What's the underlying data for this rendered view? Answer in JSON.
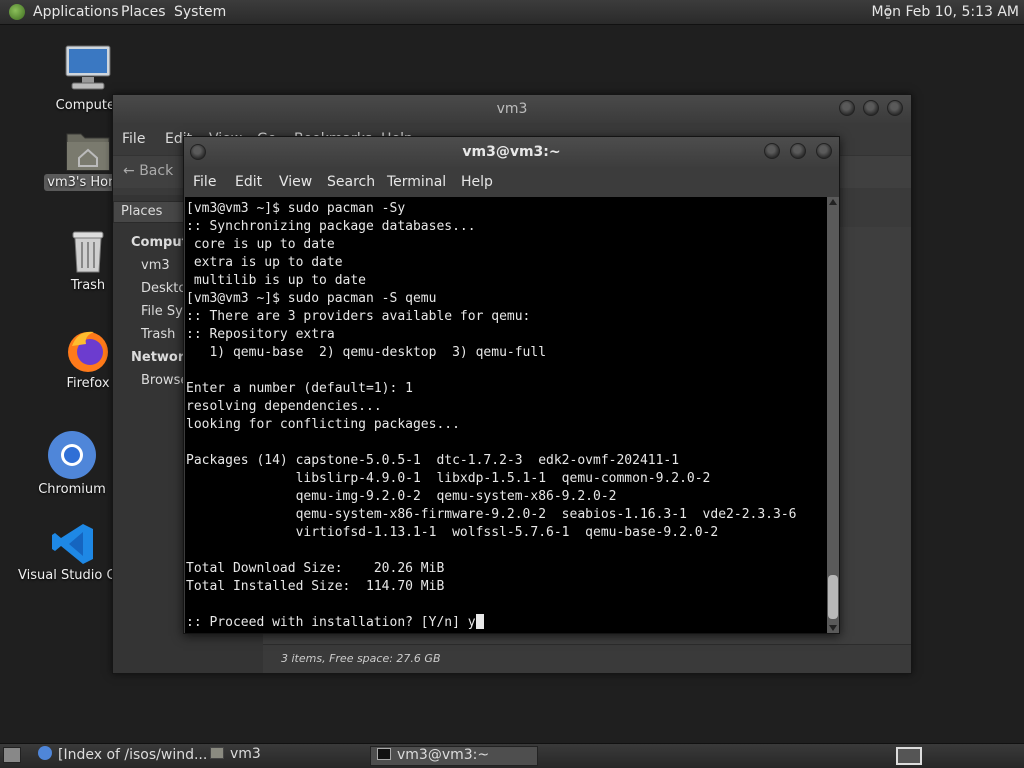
{
  "top_panel": {
    "menus": [
      "Applications",
      "Places",
      "System"
    ],
    "clock": "Mon Feb 10,  5:13 AM"
  },
  "desktop": {
    "icons": [
      {
        "label": "Computer",
        "icon": "computer-icon"
      },
      {
        "label": "vm3's Home",
        "icon": "home-folder-icon"
      },
      {
        "label": "Trash",
        "icon": "trash-icon"
      },
      {
        "label": "Firefox",
        "icon": "firefox-icon"
      },
      {
        "label": "Chromium",
        "icon": "chromium-icon"
      },
      {
        "label": "Visual Studio Code",
        "icon": "vscode-icon"
      }
    ]
  },
  "file_manager": {
    "title": "vm3",
    "menus": [
      "File",
      "Edit",
      "View",
      "Go",
      "Bookmarks",
      "Help"
    ],
    "back_label": "Back",
    "places_header": "Places",
    "sidebar": {
      "computer_header": "Computer",
      "computer_items": [
        "vm3",
        "Desktop",
        "File System",
        "Trash"
      ],
      "network_header": "Network",
      "network_items": [
        "Browse Network"
      ]
    },
    "status": "3 items, Free space: 27.6 GB"
  },
  "terminal": {
    "title": "vm3@vm3:~",
    "menus": [
      "File",
      "Edit",
      "View",
      "Search",
      "Terminal",
      "Help"
    ],
    "lines": [
      "[vm3@vm3 ~]$ sudo pacman -Sy",
      ":: Synchronizing package databases...",
      " core is up to date",
      " extra is up to date",
      " multilib is up to date",
      "[vm3@vm3 ~]$ sudo pacman -S qemu",
      ":: There are 3 providers available for qemu:",
      ":: Repository extra",
      "   1) qemu-base  2) qemu-desktop  3) qemu-full",
      "",
      "Enter a number (default=1): 1",
      "resolving dependencies...",
      "looking for conflicting packages...",
      "",
      "Packages (14) capstone-5.0.5-1  dtc-1.7.2-3  edk2-ovmf-202411-1",
      "              libslirp-4.9.0-1  libxdp-1.5.1-1  qemu-common-9.2.0-2",
      "              qemu-img-9.2.0-2  qemu-system-x86-9.2.0-2",
      "              qemu-system-x86-firmware-9.2.0-2  seabios-1.16.3-1  vde2-2.3.3-6",
      "              virtiofsd-1.13.1-1  wolfssl-5.7.6-1  qemu-base-9.2.0-2",
      "",
      "Total Download Size:    20.26 MiB",
      "Total Installed Size:  114.70 MiB",
      ""
    ],
    "prompt_line": ":: Proceed with installation? [Y/n] y"
  },
  "taskbar": {
    "tasks": [
      {
        "label": "[Index of /isos/wind...",
        "icon": "browser-icon",
        "active": false
      },
      {
        "label": "vm3",
        "icon": "home-folder-icon",
        "active": false
      },
      {
        "label": "vm3@vm3:~",
        "icon": "terminal-icon",
        "active": true
      }
    ]
  }
}
